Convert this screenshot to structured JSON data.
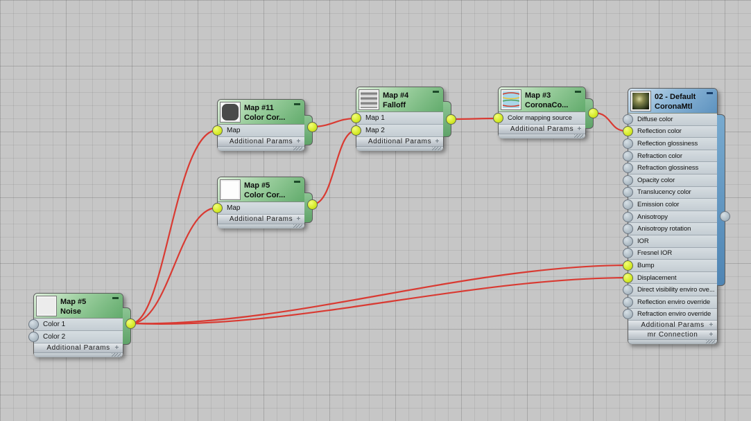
{
  "editor": {
    "view": "material-node-graph"
  },
  "colors": {
    "wire": "#d93a32",
    "socket_connected": "#d7ec2c",
    "socket_open": "#b0bdc6",
    "map_node_header": "#62ab6c",
    "material_node_header": "#5d92bf",
    "canvas_background": "#c6c6c6"
  },
  "nodes": {
    "color_correct_11": {
      "title": "Map #11",
      "subtitle": "Color  Cor...",
      "inputs": [
        "Map"
      ],
      "footers": [
        "Additional Params"
      ]
    },
    "color_correct_5": {
      "title": "Map #5",
      "subtitle": "Color  Cor...",
      "inputs": [
        "Map"
      ],
      "footers": [
        "Additional Params"
      ]
    },
    "falloff": {
      "title": "Map #4",
      "subtitle": "Falloff",
      "inputs": [
        "Map 1",
        "Map 2"
      ],
      "footers": [
        "Additional Params"
      ]
    },
    "corona_color_map": {
      "title": "Map #3",
      "subtitle": "CoronaCo...",
      "inputs": [
        "Color mapping source"
      ],
      "footers": [
        "Additional Params"
      ]
    },
    "noise": {
      "title": "Map #5",
      "subtitle": "Noise",
      "inputs": [
        "Color 1",
        "Color 2"
      ],
      "footers": [
        "Additional Params"
      ]
    },
    "corona_mtl": {
      "title": "02 - Default",
      "subtitle": "CoronaMtl",
      "inputs": [
        "Diffuse color",
        "Reflection color",
        "Reflection glossiness",
        "Refraction color",
        "Refraction glossiness",
        "Opacity color",
        "Translucency color",
        "Emission color",
        "Anisotropy",
        "Anisotropy rotation",
        "IOR",
        "Fresnel IOR",
        "Bump",
        "Displacement",
        "Direct visibility enviro ove...",
        "Reflection enviro override",
        "Refraction enviro override"
      ],
      "footers": [
        "Additional Params",
        "mr Connection"
      ]
    }
  }
}
